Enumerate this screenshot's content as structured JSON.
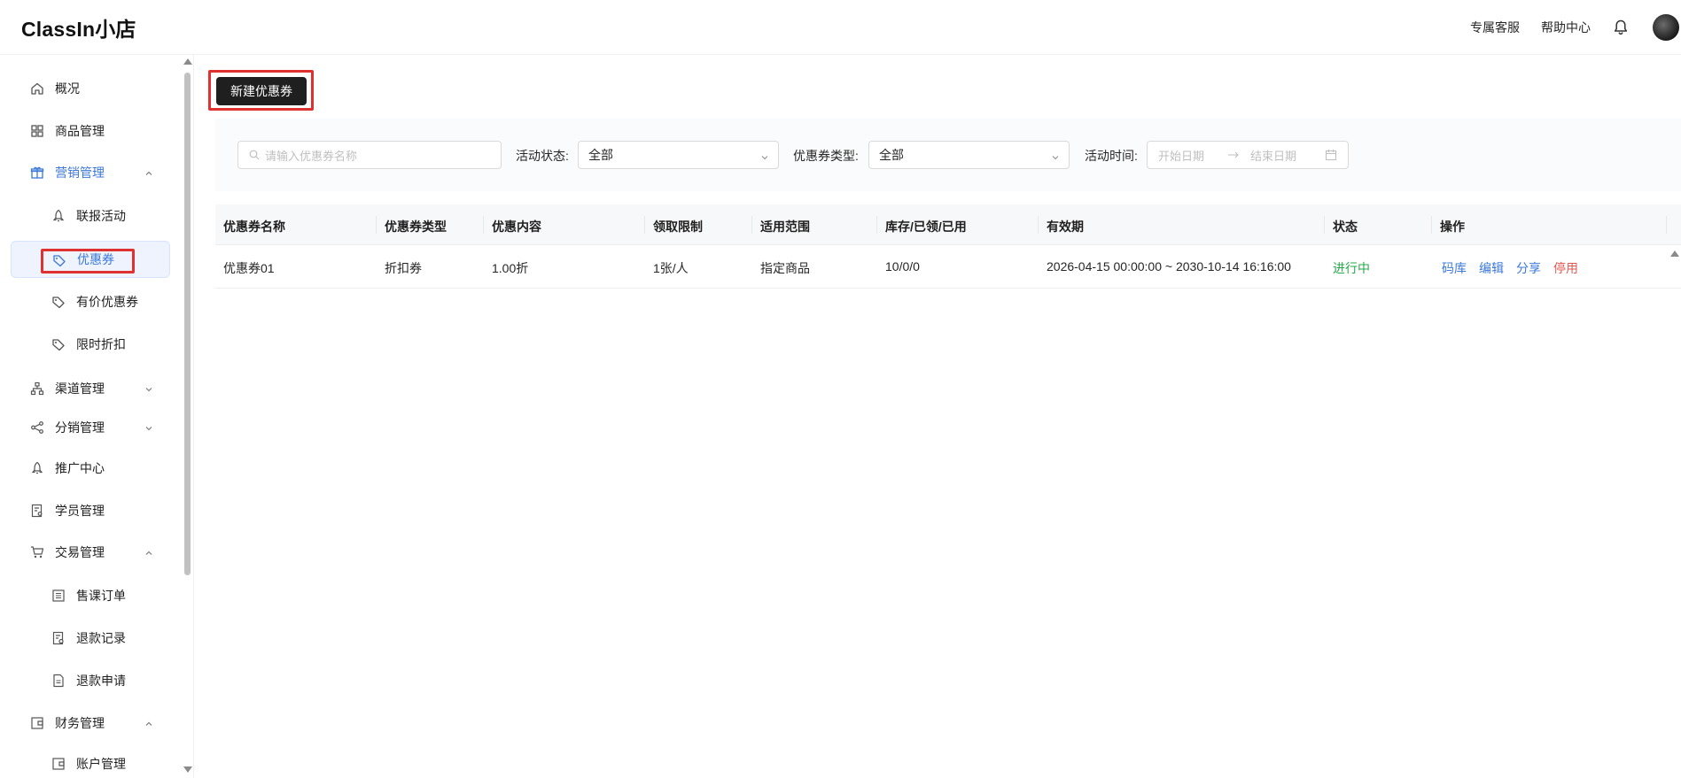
{
  "app": {
    "logo": "ClassIn小店"
  },
  "header": {
    "links": [
      "专属客服",
      "帮助中心"
    ],
    "icons": [
      "bell-icon",
      "avatar"
    ]
  },
  "sidebar": {
    "items": [
      {
        "label": "概况",
        "icon": "home-icon"
      },
      {
        "label": "商品管理",
        "icon": "grid-icon"
      },
      {
        "label": "营销管理",
        "icon": "gift-icon",
        "expanded": true
      },
      {
        "label": "联报活动",
        "icon": "rocket-icon"
      },
      {
        "label": "优惠券",
        "icon": "tag-icon",
        "active": true
      },
      {
        "label": "有价优惠券",
        "icon": "tag-icon"
      },
      {
        "label": "限时折扣",
        "icon": "tag-icon"
      },
      {
        "label": "渠道管理",
        "icon": "org-icon",
        "expanded": false
      },
      {
        "label": "分销管理",
        "icon": "share-icon",
        "expanded": false
      },
      {
        "label": "推广中心",
        "icon": "rocket-icon"
      },
      {
        "label": "学员管理",
        "icon": "student-icon"
      },
      {
        "label": "交易管理",
        "icon": "cart-icon",
        "expanded": true
      },
      {
        "label": "售课订单",
        "icon": "list-icon"
      },
      {
        "label": "退款记录",
        "icon": "refund-icon"
      },
      {
        "label": "退款申请",
        "icon": "doc-icon"
      },
      {
        "label": "财务管理",
        "icon": "wallet-icon",
        "expanded": true
      },
      {
        "label": "账户管理",
        "icon": "wallet-icon"
      }
    ]
  },
  "toolbar": {
    "new_label": "新建优惠券"
  },
  "filters": {
    "search_placeholder": "请输入优惠券名称",
    "status_label": "活动状态:",
    "status_value": "全部",
    "type_label": "优惠券类型:",
    "type_value": "全部",
    "time_label": "活动时间:",
    "start_placeholder": "开始日期",
    "end_placeholder": "结束日期"
  },
  "table": {
    "columns": [
      "优惠券名称",
      "优惠券类型",
      "优惠内容",
      "领取限制",
      "适用范围",
      "库存/已领/已用",
      "有效期",
      "状态",
      "操作"
    ],
    "rows": [
      {
        "name": "优惠券01",
        "type": "折扣券",
        "content": "1.00折",
        "limit": "1张/人",
        "scope": "指定商品",
        "stock": "10/0/0",
        "validity": "2026-04-15 00:00:00 ~ 2030-10-14 16:16:00",
        "status": "进行中",
        "actions": [
          "码库",
          "编辑",
          "分享",
          "停用"
        ]
      }
    ]
  },
  "colors": {
    "accent": "#3c78d8",
    "status_active": "#27a84a",
    "danger": "#e0574f",
    "highlight_box": "#e03131",
    "primary_button": "#1f1f1f"
  }
}
